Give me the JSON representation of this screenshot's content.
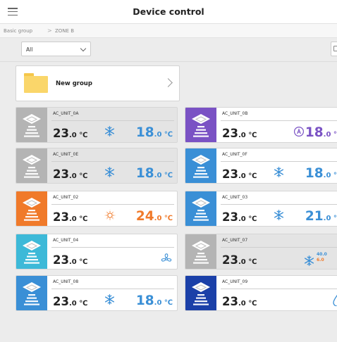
{
  "header": {
    "title": "Device control",
    "menu_icon": "hamburger-menu-icon"
  },
  "breadcrumb": {
    "items": [
      "Basic group",
      "ZONE B"
    ],
    "separator": ">"
  },
  "filter": {
    "value": "All",
    "icon": "chevron-down-icon"
  },
  "toolbar_icon": "select-icon",
  "group": {
    "name": "New group",
    "icon": "folder-icon"
  },
  "colors": {
    "accent_blue": "#3a8fd6",
    "orange": "#f07a2a",
    "purple": "#7a52c4",
    "off_gray": "#b4b4b4",
    "cyan": "#3db9d8",
    "navy": "#1b40a8"
  },
  "units": [
    {
      "name": "AC_UNIT_0A",
      "temp": "23",
      "temp_dec": ".0",
      "unit": "℃",
      "mode": "cool",
      "set": "18",
      "set_dec": ".0",
      "set_unit": "℃",
      "tile": "gray",
      "off": true
    },
    {
      "name": "AC_UNIT_0B",
      "temp": "23",
      "temp_dec": ".0",
      "unit": "℃",
      "mode": "auto",
      "set": "18",
      "set_dec": ".0",
      "set_unit": "℃",
      "tile": "purple",
      "off": false
    },
    {
      "name": "AC_UNIT_0E",
      "temp": "23",
      "temp_dec": ".0",
      "unit": "℃",
      "mode": "cool",
      "set": "18",
      "set_dec": ".0",
      "set_unit": "℃",
      "tile": "gray",
      "off": true
    },
    {
      "name": "AC_UNIT_0F",
      "temp": "23",
      "temp_dec": ".0",
      "unit": "℃",
      "mode": "cool",
      "set": "18",
      "set_dec": ".0",
      "set_unit": "℃",
      "tile": "blue",
      "off": false
    },
    {
      "name": "AC_UNIT_02",
      "temp": "23",
      "temp_dec": ".0",
      "unit": "℃",
      "mode": "heat",
      "set": "24",
      "set_dec": ".0",
      "set_unit": "℃",
      "tile": "orange",
      "off": false
    },
    {
      "name": "AC_UNIT_03",
      "temp": "23",
      "temp_dec": ".0",
      "unit": "℃",
      "mode": "cool",
      "set": "21",
      "set_dec": ".0",
      "set_unit": "℃",
      "tile": "blue",
      "off": false
    },
    {
      "name": "AC_UNIT_04",
      "temp": "23",
      "temp_dec": ".0",
      "unit": "℃",
      "mode": "fan",
      "tile": "cyan",
      "off": false
    },
    {
      "name": "AC_UNIT_07",
      "temp": "23",
      "temp_dec": ".0",
      "unit": "℃",
      "mode": "auto-dual",
      "dual_cool": "40.0",
      "dual_heat": "6.0",
      "tile": "gray",
      "off": true
    },
    {
      "name": "AC_UNIT_08",
      "temp": "23",
      "temp_dec": ".0",
      "unit": "℃",
      "mode": "cool",
      "set": "18",
      "set_dec": ".0",
      "set_unit": "℃",
      "tile": "blue",
      "off": false
    },
    {
      "name": "AC_UNIT_09",
      "temp": "23",
      "temp_dec": ".0",
      "unit": "℃",
      "mode": "dry",
      "tile": "navy",
      "off": false
    }
  ]
}
